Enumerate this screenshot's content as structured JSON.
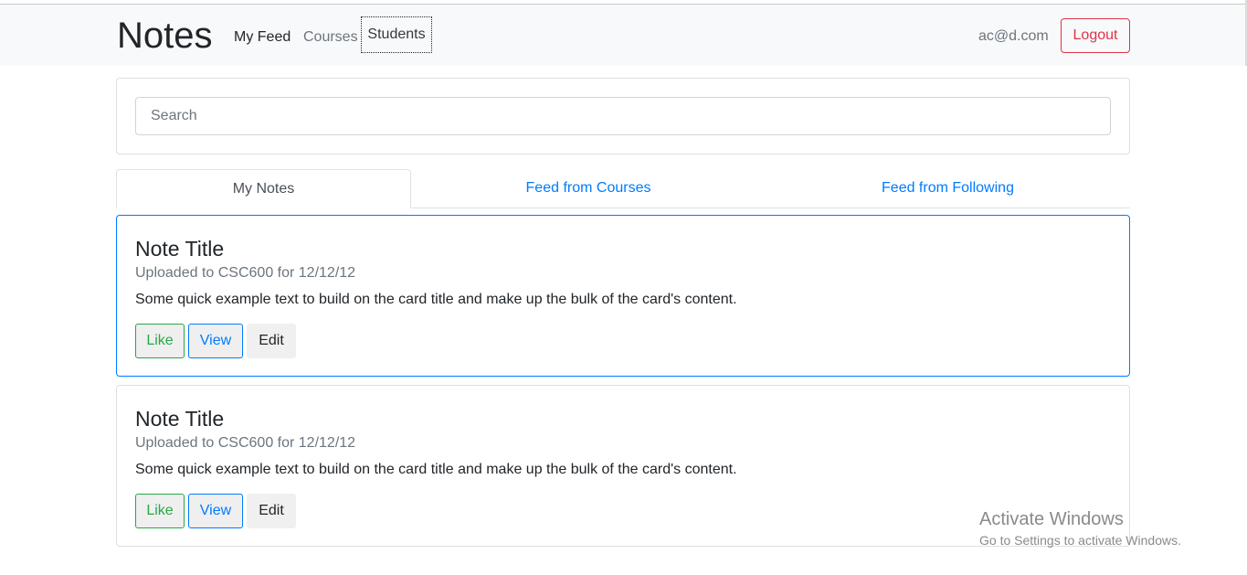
{
  "navbar": {
    "brand": "Notes",
    "links": [
      "My Feed",
      "Courses",
      "Students"
    ],
    "user_email": "ac@d.com",
    "logout_label": "Logout"
  },
  "search": {
    "placeholder": "Search",
    "value": ""
  },
  "tabs": [
    "My Notes",
    "Feed from Courses",
    "Feed from Following"
  ],
  "active_tab": "My Notes",
  "notes": [
    {
      "title": "Note Title",
      "subtitle": "Uploaded to CSC600 for 12/12/12",
      "text": "Some quick example text to build on the card title and make up the bulk of the card's content.",
      "like_label": "Like",
      "view_label": "View",
      "edit_label": "Edit"
    },
    {
      "title": "Note Title",
      "subtitle": "Uploaded to CSC600 for 12/12/12",
      "text": "Some quick example text to build on the card title and make up the bulk of the card's content.",
      "like_label": "Like",
      "view_label": "View",
      "edit_label": "Edit"
    }
  ],
  "watermark": {
    "title": "Activate Windows",
    "subtitle": "Go to Settings to activate Windows."
  },
  "colors": {
    "primary": "#007bff",
    "success": "#28a745",
    "danger": "#dc3545",
    "muted": "#6c757d",
    "navbar_bg": "#f8f9fa"
  }
}
